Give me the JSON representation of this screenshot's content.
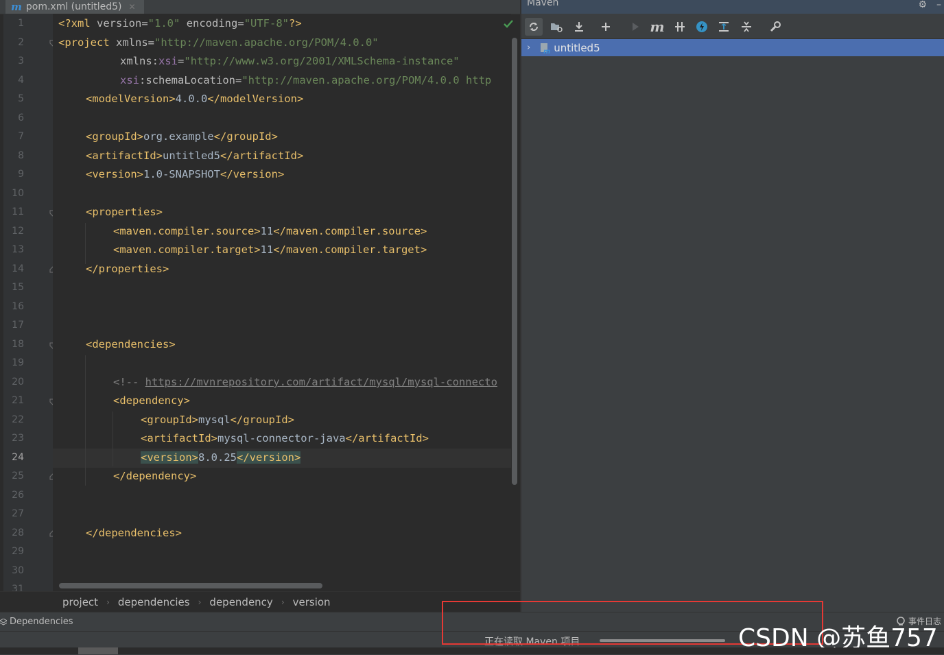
{
  "tab": {
    "title": "pom.xml (untitled5)",
    "icon": "maven-m-icon"
  },
  "gutter": {
    "line_numbers": [
      "1",
      "2",
      "3",
      "4",
      "5",
      "6",
      "7",
      "8",
      "9",
      "10",
      "11",
      "12",
      "13",
      "14",
      "15",
      "16",
      "17",
      "18",
      "19",
      "20",
      "21",
      "22",
      "23",
      "24",
      "25",
      "26",
      "27",
      "28",
      "29",
      "30",
      "31"
    ],
    "current_line": "24"
  },
  "code": {
    "l1": {
      "a": "<?xml ",
      "b": "version",
      "c": "=",
      "d": "\"1.0\"",
      "e": " ",
      "f": "encoding",
      "g": "=",
      "h": "\"UTF-8\"",
      "i": "?>"
    },
    "l2": {
      "a": "<project ",
      "b": "xmlns",
      "c": "=",
      "d": "\"http://maven.apache.org/POM/4.0.0\""
    },
    "l3": {
      "a": "xmlns",
      "b": ":",
      "c": "xsi",
      "d": "=",
      "e": "\"http://www.w3.org/2001/XMLSchema-instance\""
    },
    "l4": {
      "a": "xsi",
      "b": ":schemaLocation",
      "c": "=",
      "d": "\"http://maven.apache.org/POM/4.0.0 http"
    },
    "l5": {
      "open": "<modelVersion>",
      "text": "4.0.0",
      "close": "</modelVersion>"
    },
    "l7": {
      "open": "<groupId>",
      "text": "org.example",
      "close": "</groupId>"
    },
    "l8": {
      "open": "<artifactId>",
      "text": "untitled5",
      "close": "</artifactId>"
    },
    "l9": {
      "open": "<version>",
      "text": "1.0-SNAPSHOT",
      "close": "</version>"
    },
    "l11": {
      "open": "<properties>"
    },
    "l12": {
      "open": "<maven.compiler.source>",
      "text": "11",
      "close": "</maven.compiler.source>"
    },
    "l13": {
      "open": "<maven.compiler.target>",
      "text": "11",
      "close": "</maven.compiler.target>"
    },
    "l14": {
      "close": "</properties>"
    },
    "l18": {
      "open": "<dependencies>"
    },
    "l20": {
      "comment": "<!-- ",
      "url": "https://mvnrepository.com/artifact/mysql/mysql-connecto"
    },
    "l21": {
      "open": "<dependency>"
    },
    "l22": {
      "open": "<groupId>",
      "text": "mysql",
      "close": "</groupId>"
    },
    "l23": {
      "open": "<artifactId>",
      "text": "mysql-connector-java",
      "close": "</artifactId>"
    },
    "l24": {
      "open": "<version>",
      "text": "8.0.25",
      "close": "</version>"
    },
    "l25": {
      "close": "</dependency>"
    },
    "l28": {
      "close": "</dependencies>"
    }
  },
  "breadcrumb": {
    "items": [
      "project",
      "dependencies",
      "dependency",
      "version"
    ]
  },
  "maven": {
    "title": "Maven",
    "toolbar": [
      "reload-icon",
      "generate-sources-icon",
      "download-icon",
      "add-icon",
      "run-icon",
      "execute-goal-icon",
      "toggle-offline-icon",
      "skip-tests-icon",
      "show-dependencies-icon",
      "collapse-all-icon",
      "settings-wrench-icon"
    ],
    "tree": {
      "project": "untitled5"
    }
  },
  "status": {
    "dependencies_tab": "Dependencies",
    "progress_text": "正在读取 Maven 项目...",
    "progress": 1.0,
    "event_log": "事件日志"
  },
  "watermark": "CSDN @苏鱼757",
  "colors": {
    "tag": "#e8bf6a",
    "string": "#6a8759",
    "namespace": "#9876aa",
    "selection": "#4b6eaf",
    "highlight_box": "#e53935"
  }
}
